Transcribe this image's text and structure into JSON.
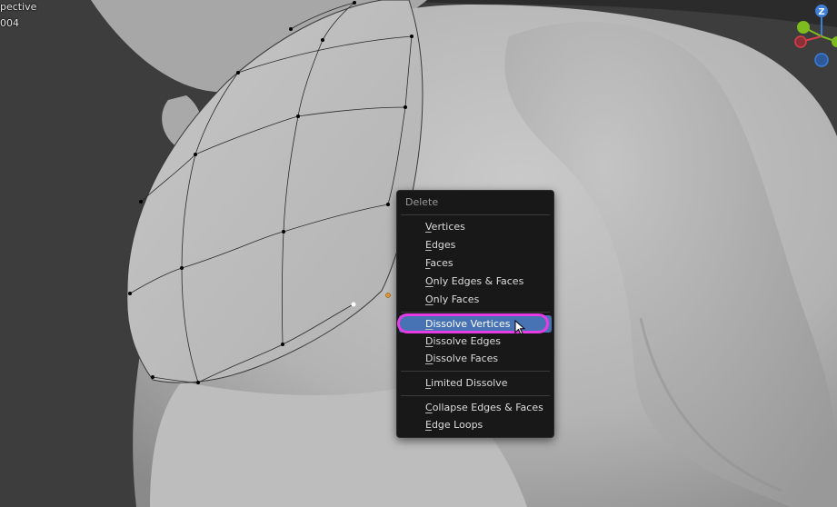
{
  "viewport": {
    "view_label": "pective",
    "object_label": "004"
  },
  "gizmo": {
    "z_label": "Z"
  },
  "context_menu": {
    "title": "Delete",
    "items": [
      {
        "first": "V",
        "rest": "ertices"
      },
      {
        "first": "E",
        "rest": "dges"
      },
      {
        "first": "F",
        "rest": "aces"
      },
      {
        "first": "O",
        "rest": "nly Edges & Faces"
      },
      {
        "first": "O",
        "rest": "nly Faces"
      },
      {
        "first": "D",
        "rest": "issolve Vertices"
      },
      {
        "first": "D",
        "rest": "issolve Edges"
      },
      {
        "first": "D",
        "rest": "issolve Faces"
      },
      {
        "first": "L",
        "rest": "imited Dissolve"
      },
      {
        "first": "C",
        "rest": "ollapse Edges & Faces"
      },
      {
        "first": "E",
        "rest": "dge Loops"
      }
    ]
  },
  "colors": {
    "menu_bg": "#181818",
    "active_item": "#4772b3",
    "highlight_ring": "#e63ce6",
    "axis_x": "#d9404a",
    "axis_y": "#7cbc1e",
    "axis_z": "#3d7ed8"
  }
}
